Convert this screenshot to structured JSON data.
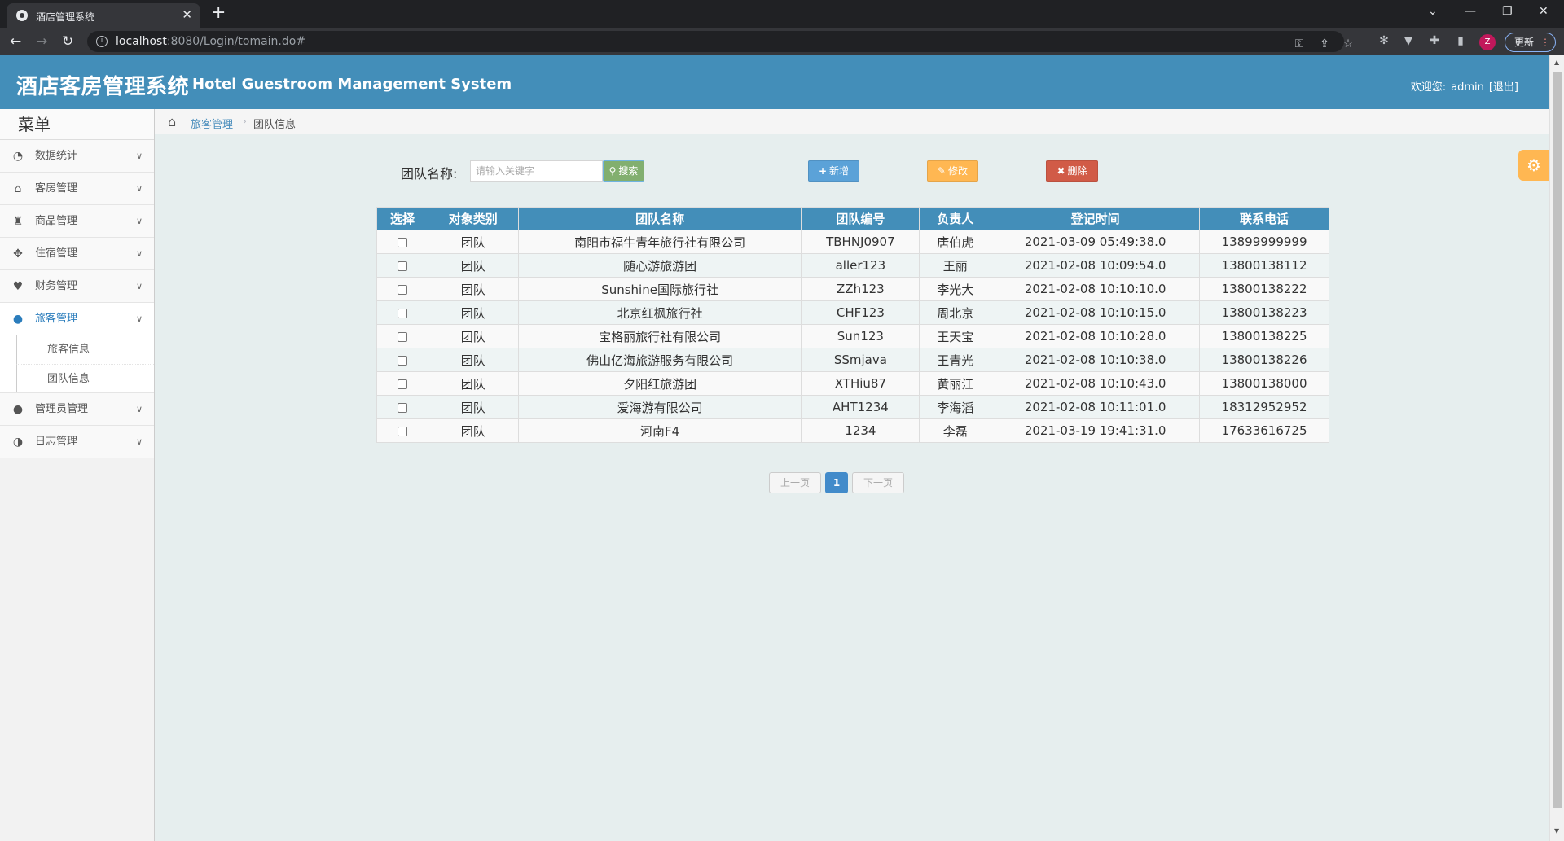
{
  "browser": {
    "tab_title": "酒店管理系统",
    "tab_close": "✕",
    "new_tab": "+",
    "url_host": "localhost",
    "url_rest": ":8080/Login/tomain.do#",
    "update_label": "更新",
    "profile_initial": "Z",
    "window_controls": {
      "dropdown": "⌄",
      "minimize": "—",
      "restore": "❐",
      "close": "✕"
    }
  },
  "header": {
    "title": "酒店客房管理系统",
    "subtitle": "Hotel Guestroom Management System",
    "welcome_label": "欢迎您:",
    "username": "admin",
    "logout": "[退出]"
  },
  "sidebar": {
    "title": "菜单",
    "items": [
      {
        "label": "数据统计",
        "icon": "dashboard-icon"
      },
      {
        "label": "客房管理",
        "icon": "home-icon"
      },
      {
        "label": "商品管理",
        "icon": "beer-icon"
      },
      {
        "label": "住宿管理",
        "icon": "move-icon"
      },
      {
        "label": "财务管理",
        "icon": "heart-icon"
      },
      {
        "label": "旅客管理",
        "icon": "user-icon",
        "active": true
      },
      {
        "label": "管理员管理",
        "icon": "user-icon"
      },
      {
        "label": "日志管理",
        "icon": "adjust-icon"
      }
    ],
    "submenu": [
      {
        "label": "旅客信息"
      },
      {
        "label": "团队信息"
      }
    ]
  },
  "breadcrumb": {
    "parent": "旅客管理",
    "separator": "›",
    "current": "团队信息"
  },
  "toolbar": {
    "search_label": "团队名称:",
    "search_placeholder": "请输入关键字",
    "search_button": "搜索",
    "add_button": "新增",
    "edit_button": "修改",
    "delete_button": "删除"
  },
  "table": {
    "headers": [
      "选择",
      "对象类别",
      "团队名称",
      "团队编号",
      "负责人",
      "登记时间",
      "联系电话"
    ],
    "rows": [
      {
        "type": "团队",
        "name": "南阳市福牛青年旅行社有限公司",
        "code": "TBHNJ0907",
        "leader": "唐伯虎",
        "time": "2021-03-09 05:49:38.0",
        "phone": "13899999999"
      },
      {
        "type": "团队",
        "name": "随心游旅游团",
        "code": "aller123",
        "leader": "王丽",
        "time": "2021-02-08 10:09:54.0",
        "phone": "13800138112"
      },
      {
        "type": "团队",
        "name": "Sunshine国际旅行社",
        "code": "ZZh123",
        "leader": "李光大",
        "time": "2021-02-08 10:10:10.0",
        "phone": "13800138222"
      },
      {
        "type": "团队",
        "name": "北京红枫旅行社",
        "code": "CHF123",
        "leader": "周北京",
        "time": "2021-02-08 10:10:15.0",
        "phone": "13800138223"
      },
      {
        "type": "团队",
        "name": "宝格丽旅行社有限公司",
        "code": "Sun123",
        "leader": "王天宝",
        "time": "2021-02-08 10:10:28.0",
        "phone": "13800138225"
      },
      {
        "type": "团队",
        "name": "佛山亿海旅游服务有限公司",
        "code": "SSmjava",
        "leader": "王青光",
        "time": "2021-02-08 10:10:38.0",
        "phone": "13800138226"
      },
      {
        "type": "团队",
        "name": "夕阳红旅游团",
        "code": "XTHiu87",
        "leader": "黄丽江",
        "time": "2021-02-08 10:10:43.0",
        "phone": "13800138000"
      },
      {
        "type": "团队",
        "name": "爱海游有限公司",
        "code": "AHT1234",
        "leader": "李海滔",
        "time": "2021-02-08 10:11:01.0",
        "phone": "18312952952"
      },
      {
        "type": "团队",
        "name": "河南F4",
        "code": "1234",
        "leader": "李磊",
        "time": "2021-03-19 19:41:31.0",
        "phone": "17633616725"
      }
    ]
  },
  "pagination": {
    "prev": "上一页",
    "current": "1",
    "next": "下一页"
  },
  "colors": {
    "header_bg": "#438eb9",
    "btn_search": "#82af6f",
    "btn_add": "#5ba2d8",
    "btn_edit": "#ffb752",
    "btn_delete": "#d15b47"
  }
}
